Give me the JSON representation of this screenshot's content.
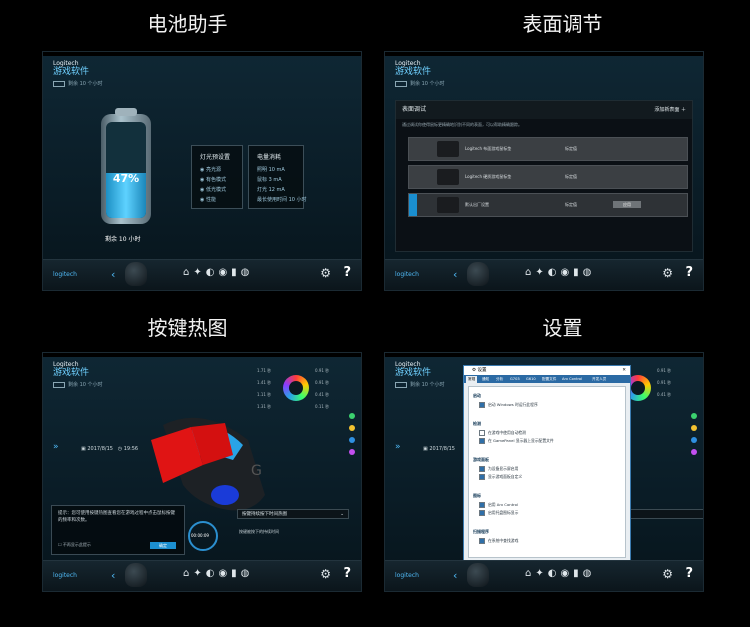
{
  "captions": [
    "电池助手",
    "表面调节",
    "按键热图",
    "设置"
  ],
  "app": {
    "brand": "Logitech",
    "name_cn": "游戏软件",
    "battery_status": "剩余 10 个小时"
  },
  "bottom_bar": {
    "logo_text": "logitech"
  },
  "battery_panel": {
    "percent": "47%",
    "percent_value": 47,
    "remaining": "剩余 10 小时",
    "light_box": {
      "title": "灯光预设置",
      "options": [
        "亮光源",
        "有色模式",
        "低光模式",
        "性能"
      ]
    },
    "power_box": {
      "title": "电量消耗",
      "rows": [
        "照明 10 mA",
        "鼠标 3 mA",
        "灯光 12 mA",
        "最长使用时间 10 小时"
      ]
    }
  },
  "surface_panel": {
    "title": "表面调试",
    "add_label": "添加新表面",
    "subtitle": "通过调试你使得鼠标更精确地识别不同的表面，可以帮助精确跟踪。",
    "rows": [
      {
        "name": "Logitech 布面游戏鼠标垫",
        "type": "标定值"
      },
      {
        "name": "Logitech 硬质游戏鼠标垫",
        "type": "标定值"
      },
      {
        "name": "默认出厂设置",
        "type": "标定值",
        "button": "应用"
      }
    ]
  },
  "heatmap_panel": {
    "date": "2017/8/15",
    "time": "19:56",
    "play_time": "00:00:09",
    "info_text": "提示：您可使用按键热图查看您在游戏过程中点击鼠标按键的频率和次数。",
    "checkbox_label": "不再显示此提示",
    "ok_label": "确定",
    "dropdown": "按键持续按下时间热图",
    "dropdown_desc": "按键被按下的持续时间",
    "dial_labels": [
      "1.71 秒",
      "1.41 秒",
      "1.11 秒",
      "1.31 秒",
      "0.91 秒",
      "0.91 秒",
      "0.41 秒",
      "0.11 秒"
    ]
  },
  "settings_panel": {
    "dialog_title": "设置",
    "tabs": [
      "常规",
      "通知",
      "分析",
      "G703",
      "G610",
      "配置文件",
      "Arx Control",
      "开发人员"
    ],
    "sections": [
      {
        "title": "启动",
        "options": [
          {
            "label": "启动 Windows 时运行此程序",
            "checked": true
          }
        ]
      },
      {
        "title": "检测",
        "options": [
          {
            "label": "在游戏中使用自动检测",
            "checked": false
          },
          {
            "label": "在 GamePanel 显示器上显示配置文件",
            "checked": true
          }
        ]
      },
      {
        "title": "游戏面板",
        "options": [
          {
            "label": "为设备显示屏启用",
            "checked": true
          },
          {
            "label": "显示游戏面板自定义",
            "checked": true
          }
        ]
      },
      {
        "title": "图标",
        "options": [
          {
            "label": "启用 Arx Control",
            "checked": true
          },
          {
            "label": "启用托盘图标显示",
            "checked": true
          }
        ]
      },
      {
        "title": "扫描程序",
        "options": [
          {
            "label": "在系统中查找游戏",
            "checked": true
          }
        ]
      }
    ],
    "buttons": [
      "默认",
      "确定",
      "取消"
    ]
  },
  "colors": {
    "accent": "#1c8fd0",
    "panel_bg": "#0f2734",
    "heat_red": "#e01414",
    "heat_blue": "#1a3bd8",
    "heat_cyan": "#29a3e6"
  }
}
